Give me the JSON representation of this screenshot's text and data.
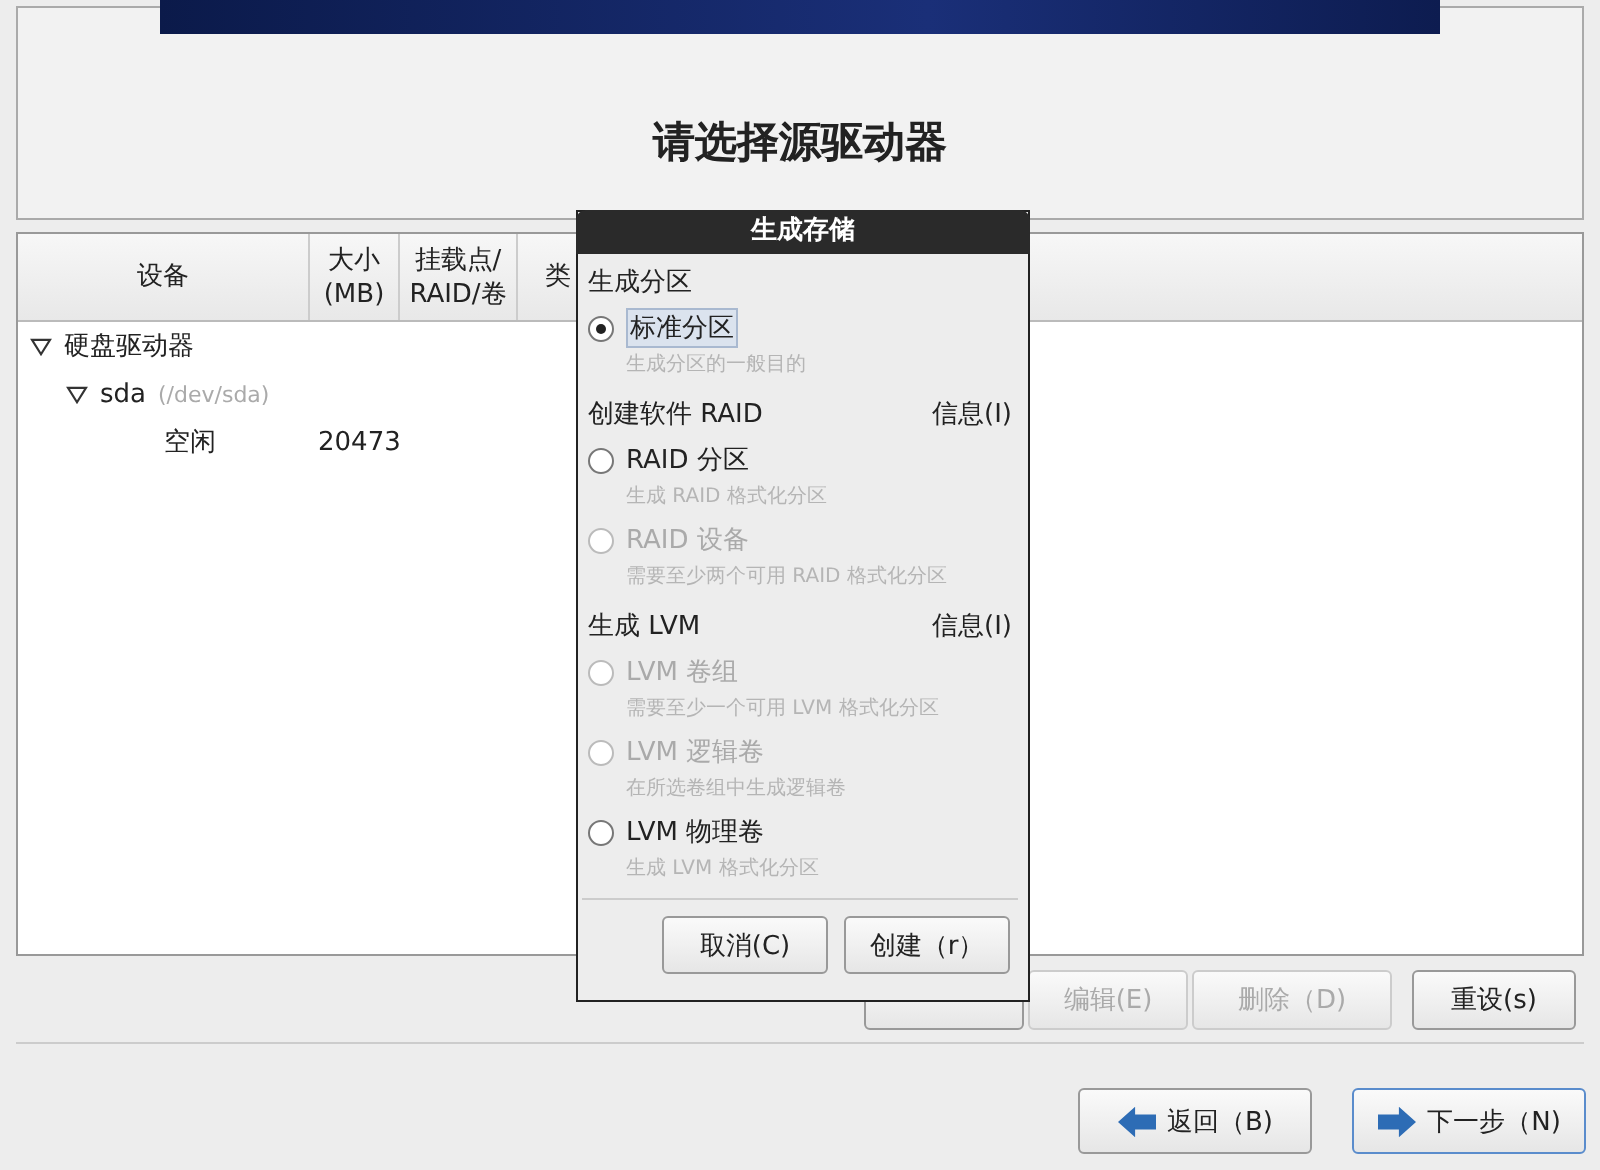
{
  "title": "请选择源驱动器",
  "table": {
    "columns": [
      {
        "lines": [
          "设备"
        ]
      },
      {
        "lines": [
          "大小",
          "(MB)"
        ]
      },
      {
        "lines": [
          "挂载点/",
          "RAID/卷"
        ]
      },
      {
        "lines": [
          "类"
        ]
      }
    ],
    "rows": [
      {
        "device": "硬盘驱动器",
        "expanded": true,
        "children": [
          {
            "device": "sda",
            "path": "(/dev/sda)",
            "expanded": true,
            "children": [
              {
                "device": "空闲",
                "size": "20473"
              }
            ]
          }
        ]
      }
    ]
  },
  "actions": [
    {
      "label": "编辑(E)",
      "disabled": true
    },
    {
      "label": "删除（D)",
      "disabled": true
    },
    {
      "label": "重设(s)",
      "disabled": false
    }
  ],
  "nav": [
    {
      "kind": "back",
      "label": "返回（B)",
      "focused": false
    },
    {
      "kind": "next",
      "label": "下一步（N)",
      "focused": true
    }
  ],
  "dialog": {
    "title": "生成存储",
    "sections": [
      {
        "heading": "生成分区",
        "options": [
          {
            "label": "标准分区",
            "description": "生成分区的一般目的",
            "selected": true,
            "disabled": false
          }
        ]
      },
      {
        "heading": "创建软件 RAID",
        "info": "信息(I)",
        "options": [
          {
            "label": "RAID 分区",
            "description": "生成 RAID 格式化分区",
            "selected": false,
            "disabled": false
          },
          {
            "label": "RAID 设备",
            "description": "需要至少两个可用 RAID 格式化分区",
            "selected": false,
            "disabled": true
          }
        ]
      },
      {
        "heading": "生成 LVM",
        "info": "信息(I)",
        "options": [
          {
            "label": "LVM 卷组",
            "description": "需要至少一个可用 LVM 格式化分区",
            "selected": false,
            "disabled": true
          },
          {
            "label": "LVM 逻辑卷",
            "description": "在所选卷组中生成逻辑卷",
            "selected": false,
            "disabled": true
          },
          {
            "label": "LVM 物理卷",
            "description": "生成 LVM 格式化分区",
            "selected": false,
            "disabled": false
          }
        ]
      }
    ],
    "buttons": [
      "取消(C)",
      "创建（r）"
    ]
  }
}
